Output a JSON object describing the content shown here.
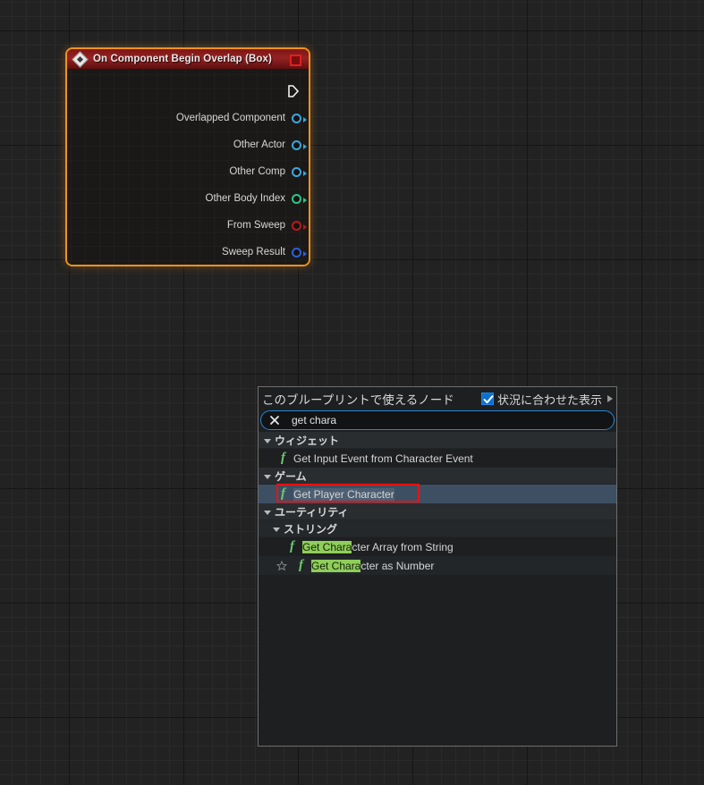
{
  "graph": {
    "node": {
      "title": "On Component Begin Overlap (Box)",
      "title_icon": "event-diamond-icon",
      "delegate_pin_name": "delegate-output-pin",
      "exec_pin_name": "exec-output-pin",
      "selection_color": "#f0921e",
      "title_color": "#962223",
      "pins": [
        {
          "label": "Overlapped Component",
          "color": "#3aa7e0",
          "type": "object"
        },
        {
          "label": "Other Actor",
          "color": "#3aa7e0",
          "type": "object"
        },
        {
          "label": "Other Comp",
          "color": "#3aa7e0",
          "type": "object"
        },
        {
          "label": "Other Body Index",
          "color": "#2bc68a",
          "type": "integer"
        },
        {
          "label": "From Sweep",
          "color": "#b81b1b",
          "type": "boolean"
        },
        {
          "label": "Sweep Result",
          "color": "#2a62d8",
          "type": "struct"
        }
      ]
    }
  },
  "menu": {
    "title": "このブループリントで使えるノード",
    "context_toggle": {
      "label": "状況に合わせた表示",
      "checked": true,
      "accent": "#0c70d0"
    },
    "search": {
      "value": "get chara",
      "placeholder": "",
      "clear_icon": "close-icon"
    },
    "results": [
      {
        "kind": "category",
        "level": 1,
        "label": "ウィジェット",
        "expanded": true
      },
      {
        "kind": "item",
        "level": 1,
        "icon": "function-icon",
        "label_parts": [
          {
            "t": "Get Input Event from Character Event",
            "hl": false
          }
        ],
        "selected": false,
        "favorite": false
      },
      {
        "kind": "category",
        "level": 1,
        "label": "ゲーム",
        "expanded": true
      },
      {
        "kind": "item",
        "level": 1,
        "icon": "function-icon",
        "label_parts": [
          {
            "t": "Get Player Character",
            "hl": false
          }
        ],
        "selected": true,
        "favorite": false,
        "annotated": true
      },
      {
        "kind": "category",
        "level": 1,
        "label": "ユーティリティ",
        "expanded": true
      },
      {
        "kind": "category",
        "level": 2,
        "label": "ストリング",
        "expanded": true
      },
      {
        "kind": "item",
        "level": 2,
        "icon": "function-icon",
        "label_parts": [
          {
            "t": "Get Chara",
            "hl": true
          },
          {
            "t": "cter Array from String",
            "hl": false
          }
        ],
        "selected": false,
        "favorite": false
      },
      {
        "kind": "item",
        "level": 2,
        "icon": "function-icon",
        "label_parts": [
          {
            "t": "Get Chara",
            "hl": true
          },
          {
            "t": "cter as Number",
            "hl": false
          }
        ],
        "selected": false,
        "favorite": true,
        "favorite_icon": "star-icon"
      }
    ],
    "highlight_color": "#8fce5a",
    "selection_color": "#3d4f63",
    "annotation_color": "#ee1111"
  }
}
